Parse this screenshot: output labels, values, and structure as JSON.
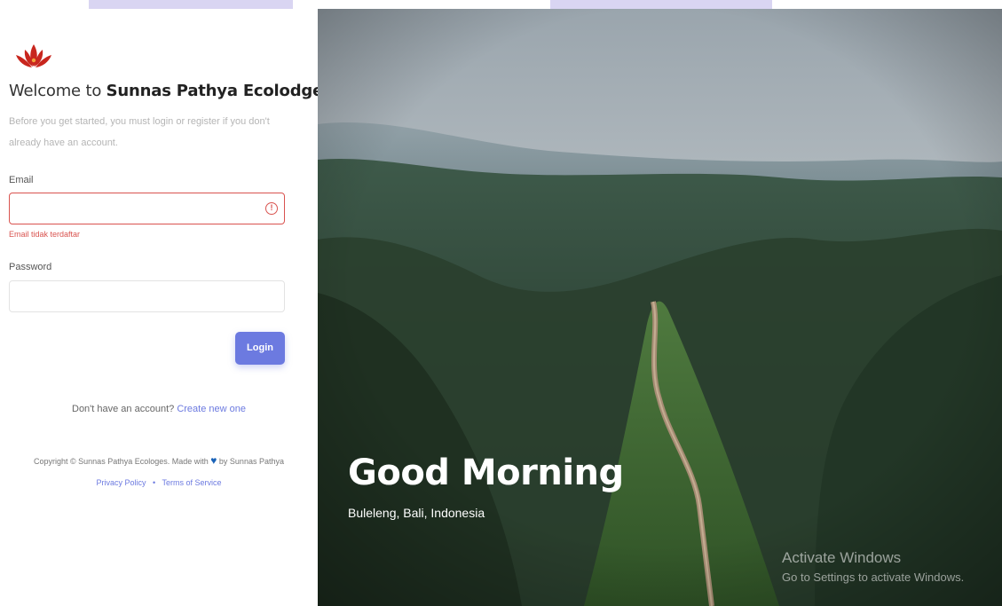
{
  "welcome": {
    "prefix": "Welcome to",
    "brand": "Sunnas Pathya Ecolodges"
  },
  "intro": "Before you get started, you must login or register if you don't already have an account.",
  "email": {
    "label": "Email",
    "value": "",
    "placeholder": "",
    "error": "Email tidak terdaftar"
  },
  "password": {
    "label": "Password",
    "value": "",
    "placeholder": ""
  },
  "login_button": "Login",
  "register": {
    "question": "Don't have an account?",
    "link": "Create new one"
  },
  "footer": {
    "copyright_prefix": "Copyright © Sunnas Pathya Ecologes. Made with",
    "copyright_suffix": "by Sunnas Pathya",
    "privacy": "Privacy Policy",
    "terms": "Terms of Service",
    "separator": "•"
  },
  "hero": {
    "greeting": "Good Morning",
    "location": "Buleleng, Bali, Indonesia"
  },
  "watermark": {
    "title": "Activate Windows",
    "subtitle": "Go to Settings to activate Windows."
  },
  "colors": {
    "accent": "#6c7ae0",
    "error": "#d9534f",
    "logo": "#c8261e"
  },
  "icons": {
    "logo": "lotus-logo-icon",
    "error": "error-circle-icon",
    "heart": "heart-icon"
  }
}
